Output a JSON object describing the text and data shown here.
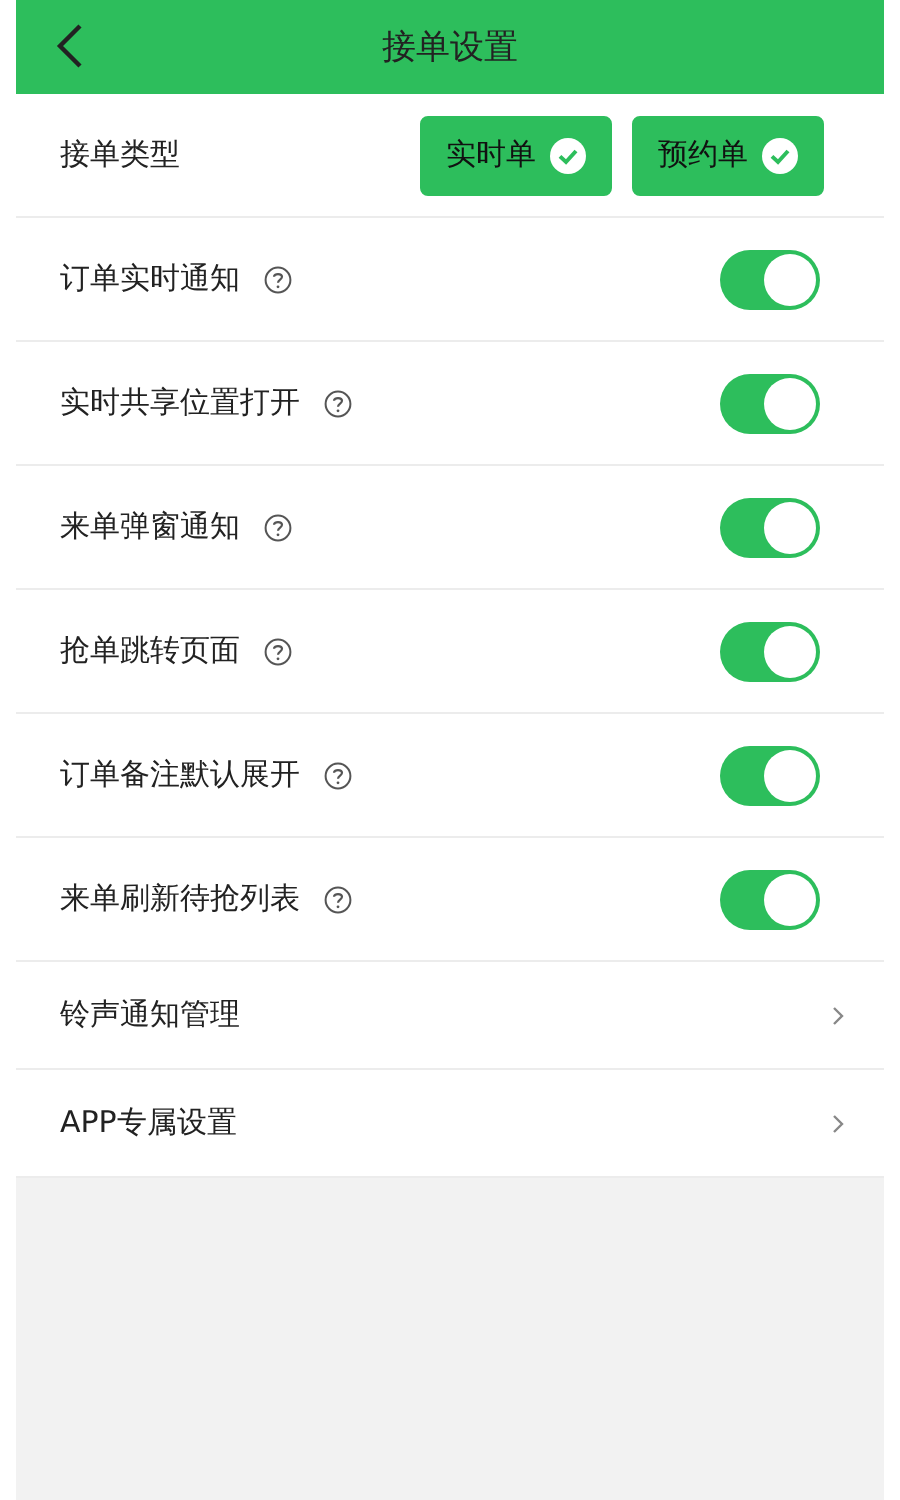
{
  "header": {
    "title": "接单设置"
  },
  "order_types": {
    "label": "接单类型",
    "options": [
      {
        "label": "实时单",
        "selected": true
      },
      {
        "label": "预约单",
        "selected": true
      }
    ]
  },
  "toggles": [
    {
      "label": "订单实时通知",
      "on": true
    },
    {
      "label": "实时共享位置打开",
      "on": true
    },
    {
      "label": "来单弹窗通知",
      "on": true
    },
    {
      "label": "抢单跳转页面",
      "on": true
    },
    {
      "label": "订单备注默认展开",
      "on": true
    },
    {
      "label": "来单刷新待抢列表",
      "on": true
    }
  ],
  "links": [
    {
      "label": "铃声通知管理"
    },
    {
      "label": "APP专属设置"
    }
  ]
}
